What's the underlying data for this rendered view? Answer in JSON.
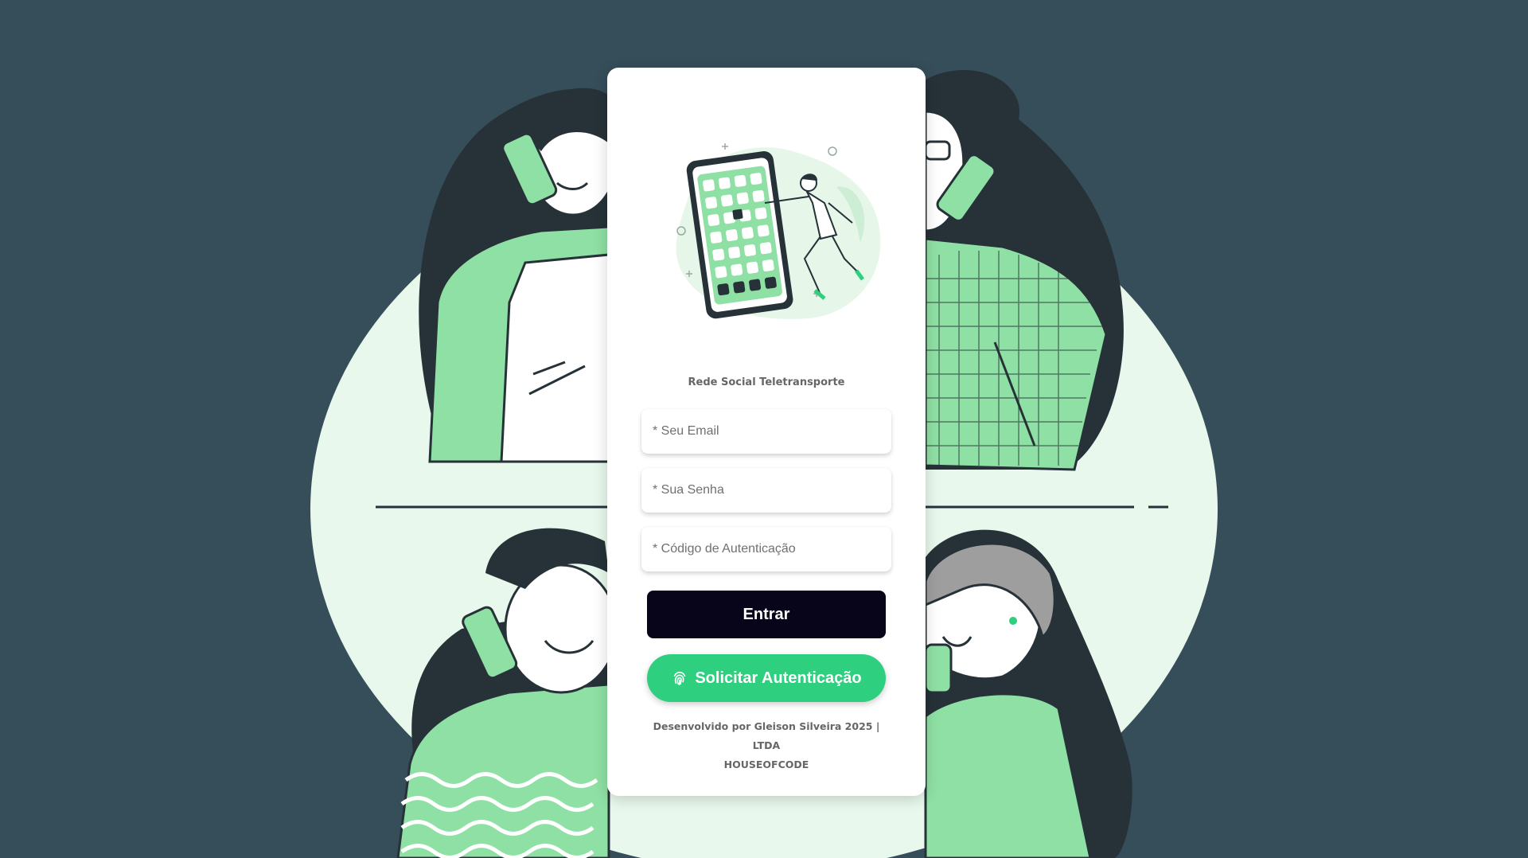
{
  "card": {
    "app_title": "Rede Social Teletransporte",
    "hero_image": "phone-app-grid-illustration"
  },
  "form": {
    "email_placeholder": "* Seu Email",
    "password_placeholder": "* Sua Senha",
    "code_placeholder": "* Código de Autenticação",
    "login_label": "Entrar",
    "auth_label": "Solicitar Autenticação",
    "auth_icon": "fingerprint-icon"
  },
  "footer": {
    "line1": "Desenvolvido por Gleison Silveira 2025 | LTDA",
    "line2": "HOUSEOFCODE"
  },
  "colors": {
    "background": "#364d5a",
    "accent_green": "#2ecf7e",
    "illustration_green": "#8fe0a4",
    "dark_button": "#08041a"
  },
  "background": {
    "illustration": "four-people-on-phone-calls"
  }
}
